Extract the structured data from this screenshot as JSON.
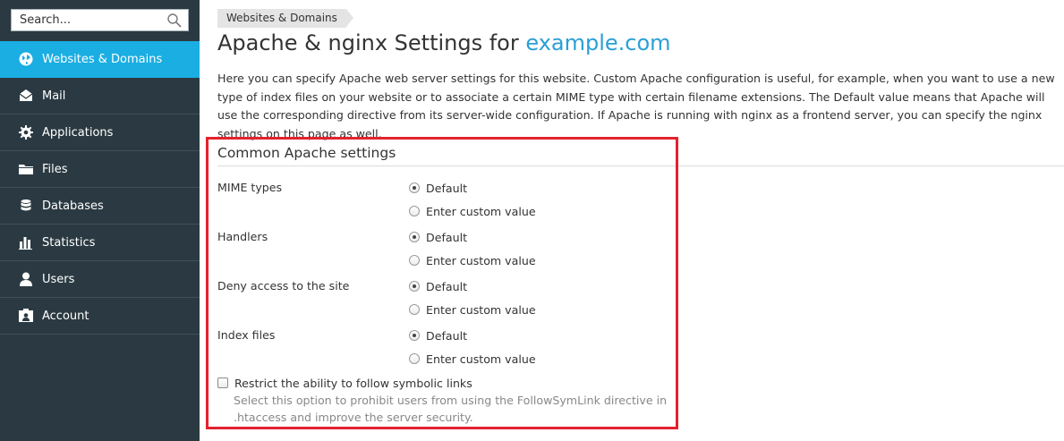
{
  "colors": {
    "sidebar_bg": "#2b3a42",
    "active_item_bg": "#1aaee3",
    "link_blue": "#2a9fd6",
    "highlight_red": "#e4222e"
  },
  "search": {
    "placeholder": "Search..."
  },
  "sidebar": {
    "items": [
      {
        "label": "Websites & Domains",
        "icon": "globe-icon",
        "active": true
      },
      {
        "label": "Mail",
        "icon": "envelope-icon",
        "active": false
      },
      {
        "label": "Applications",
        "icon": "gear-icon",
        "active": false
      },
      {
        "label": "Files",
        "icon": "folder-icon",
        "active": false
      },
      {
        "label": "Databases",
        "icon": "database-icon",
        "active": false
      },
      {
        "label": "Statistics",
        "icon": "bar-chart-icon",
        "active": false
      },
      {
        "label": "Users",
        "icon": "user-icon",
        "active": false
      },
      {
        "label": "Account",
        "icon": "id-card-icon",
        "active": false
      }
    ]
  },
  "breadcrumb": {
    "label": "Websites & Domains"
  },
  "page": {
    "title_prefix": "Apache & nginx Settings for ",
    "title_domain": "example.com",
    "description": "Here you can specify Apache web server settings for this website. Custom Apache configuration is useful, for example, when you want to use a new type of index files on your website or to associate a certain MIME type with certain filename extensions. The Default value means that Apache will use the corresponding directive from its server-wide configuration. If Apache is running with nginx as a frontend server, you can specify the nginx settings on this page as well."
  },
  "section": {
    "title": "Common Apache settings",
    "settings": [
      {
        "label": "MIME types",
        "options": [
          "Default",
          "Enter custom value"
        ],
        "selected": "Default"
      },
      {
        "label": "Handlers",
        "options": [
          "Default",
          "Enter custom value"
        ],
        "selected": "Default"
      },
      {
        "label": "Deny access to the site",
        "options": [
          "Default",
          "Enter custom value"
        ],
        "selected": "Default"
      },
      {
        "label": "Index files",
        "options": [
          "Default",
          "Enter custom value"
        ],
        "selected": "Default"
      }
    ],
    "symlink": {
      "label": "Restrict the ability to follow symbolic links",
      "checked": false,
      "hint": "Select this option to prohibit users from using the FollowSymLink directive in .htaccess and improve the server security."
    }
  }
}
